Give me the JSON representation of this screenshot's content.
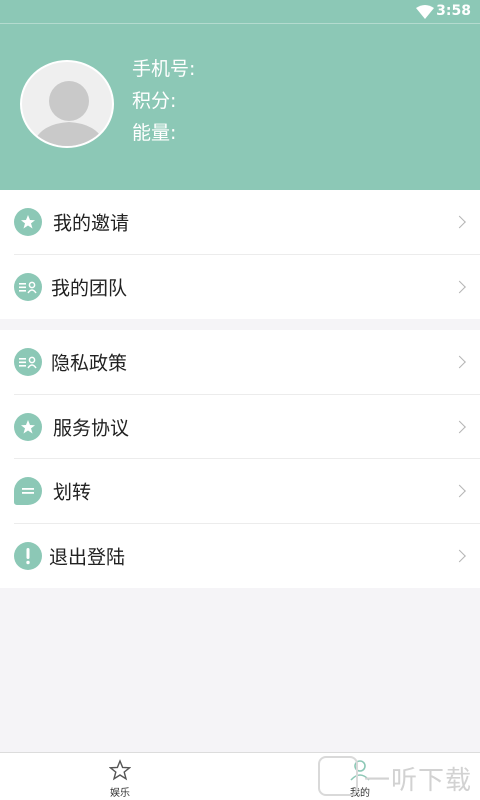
{
  "status": {
    "time": "3:58",
    "wifi_icon": "wifi-icon"
  },
  "profile": {
    "phone_label": "手机号:",
    "points_label": "积分:",
    "energy_label": "能量:"
  },
  "menu1": [
    {
      "label": "我的邀请",
      "icon": "star-icon"
    },
    {
      "label": "我的团队",
      "icon": "team-icon"
    }
  ],
  "menu2": [
    {
      "label": "隐私政策",
      "icon": "team-icon"
    },
    {
      "label": "服务协议",
      "icon": "star-icon"
    },
    {
      "label": "划转",
      "icon": "chat-icon"
    },
    {
      "label": "退出登陆",
      "icon": "exclamation-icon"
    }
  ],
  "tabs": [
    {
      "label": "娱乐",
      "icon": "star-outline-icon"
    },
    {
      "label": "我的",
      "icon": "person-icon"
    }
  ],
  "watermark": {
    "text": "一听下载"
  },
  "colors": {
    "accent": "#8cc8b6",
    "background": "#f5f4f7"
  }
}
